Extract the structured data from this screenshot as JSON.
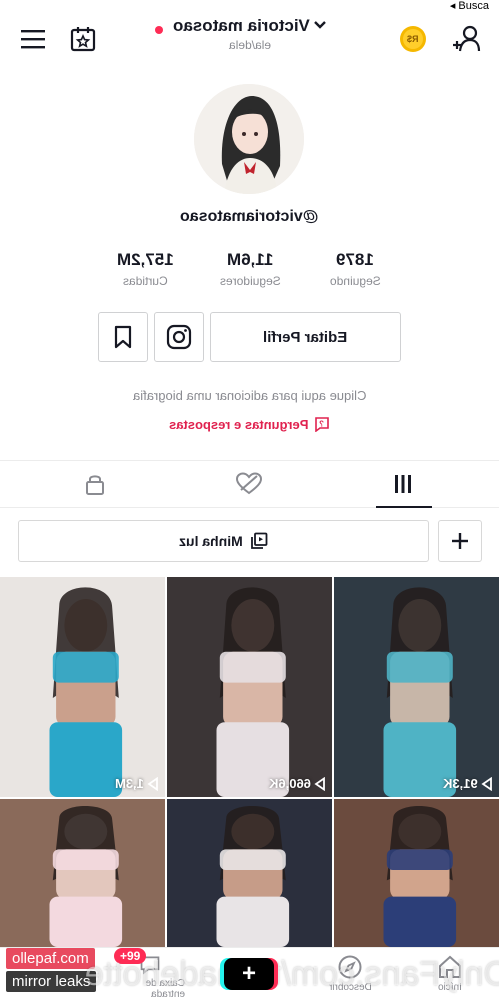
{
  "status": {
    "back_label": "◂ Busca"
  },
  "header": {
    "username": "Victoria matosao",
    "pronouns": "ela/dela",
    "coin_label": "R$"
  },
  "profile": {
    "handle": "@victoriamatosao",
    "stats": [
      {
        "value": "1879",
        "label": "Seguindo"
      },
      {
        "value": "11,6M",
        "label": "Seguidores"
      },
      {
        "value": "157,2M",
        "label": "Curtidas"
      }
    ],
    "edit_button": "Editar Perfil",
    "bio_placeholder": "Clique aqui para adicionar uma biografia",
    "qa_link": "Perguntas e respostas"
  },
  "tabs": [
    {
      "icon": "videos-grid-icon",
      "active": true
    },
    {
      "icon": "liked-hidden-icon",
      "active": false
    },
    {
      "icon": "lock-icon",
      "active": false
    }
  ],
  "mylight": {
    "label": "Minha luz"
  },
  "videos": [
    {
      "views": "91,3K",
      "palette": [
        "#2f3a44",
        "#c7b6a8",
        "#4fb3c5"
      ]
    },
    {
      "views": "660,6K",
      "palette": [
        "#3b3536",
        "#d9b6a6",
        "#e6dfe2"
      ]
    },
    {
      "views": "1,3M",
      "palette": [
        "#e9e5e2",
        "#caa08c",
        "#2aa7c9"
      ]
    },
    {
      "views": "",
      "palette": [
        "#6b4b3e",
        "#d1a48c",
        "#2c3e78"
      ]
    },
    {
      "views": "",
      "palette": [
        "#2b2f3d",
        "#c69c88",
        "#e8e4e6"
      ]
    },
    {
      "views": "",
      "palette": [
        "#8a6a5a",
        "#e3c7bd",
        "#f3d9df"
      ]
    }
  ],
  "bottom_nav": {
    "home": "Início",
    "discover": "Descobrir",
    "inbox": "Caixa de entrada"
  },
  "watermark": {
    "site": "ollepaf.com",
    "mirror": "mirror leaks",
    "badge": "+99",
    "onlyfans": "OnlyFans.com/tsunadehotte"
  },
  "colors": {
    "accent": "#fe2c55",
    "qa": "#e0224f",
    "muted": "#8a8b91",
    "coin": "#f5b800"
  }
}
